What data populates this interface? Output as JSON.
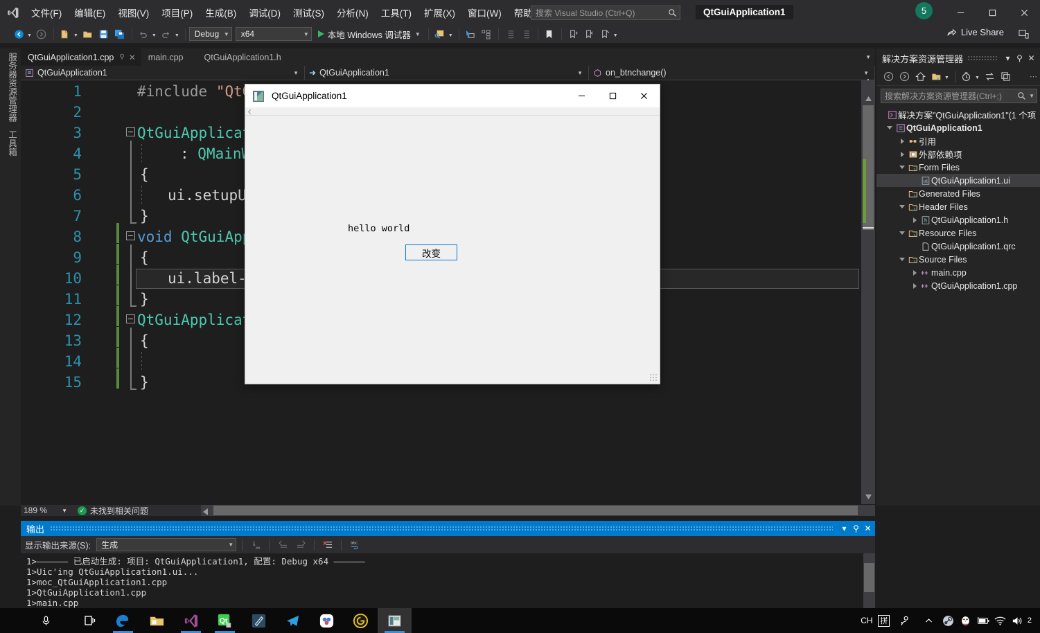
{
  "titlebar": {
    "menu": [
      "文件(F)",
      "编辑(E)",
      "视图(V)",
      "项目(P)",
      "生成(B)",
      "调试(D)",
      "测试(S)",
      "分析(N)",
      "工具(T)",
      "扩展(X)",
      "窗口(W)",
      "帮助(H)"
    ],
    "search_placeholder": "搜索 Visual Studio (Ctrl+Q)",
    "solution_name": "QtGuiApplication1",
    "notification_count": "5"
  },
  "toolbar": {
    "config": "Debug",
    "platform": "x64",
    "run_label": "本地 Windows 调试器",
    "live_share": "Live Share"
  },
  "leftstrip": {
    "server_explorer": "服务器资源管理器",
    "toolbox": "工具箱"
  },
  "tabs": [
    {
      "label": "QtGuiApplication1.cpp",
      "active": true
    },
    {
      "label": "main.cpp",
      "active": false
    },
    {
      "label": "QtGuiApplication1.h",
      "active": false
    }
  ],
  "navbar": {
    "project": "QtGuiApplication1",
    "class": "QtGuiApplication1",
    "member": "on_btnchange()"
  },
  "editor": {
    "zoom": "189 %",
    "status": "未找到相关问题",
    "lines": [
      {
        "n": "1",
        "text": "#include \"QtGuiApplication1.h\""
      },
      {
        "n": "2",
        "text": ""
      },
      {
        "n": "3",
        "text": "QtGuiApplication1::QtGuiApplication1(QWidget *parent)"
      },
      {
        "n": "4",
        "text": ": QMainWindow(parent)"
      },
      {
        "n": "5",
        "text": "{"
      },
      {
        "n": "6",
        "text": "ui.setupUi(this);"
      },
      {
        "n": "7",
        "text": "}"
      },
      {
        "n": "8",
        "text": "void QtGuiApplication1::on_btnchange()"
      },
      {
        "n": "9",
        "text": "{"
      },
      {
        "n": "10",
        "text": "ui.label->setText(\"hello world\");"
      },
      {
        "n": "11",
        "text": "}"
      },
      {
        "n": "12",
        "text": "QtGuiApplication1::~QtGuiApplication1()"
      },
      {
        "n": "13",
        "text": "{"
      },
      {
        "n": "14",
        "text": ""
      },
      {
        "n": "15",
        "text": "}"
      }
    ]
  },
  "solution_explorer": {
    "title": "解决方案资源管理器",
    "search_placeholder": "搜索解决方案资源管理器(Ctrl+;)",
    "tree": [
      {
        "label": "解决方案\"QtGuiApplication1\"(1 个项",
        "depth": 0,
        "twisty": "none",
        "icon": "solution-icon",
        "bold": false,
        "selected": false
      },
      {
        "label": "QtGuiApplication1",
        "depth": 1,
        "twisty": "down",
        "icon": "project-icon",
        "bold": true,
        "selected": false
      },
      {
        "label": "引用",
        "depth": 2,
        "twisty": "right",
        "icon": "references-icon",
        "bold": false,
        "selected": false
      },
      {
        "label": "外部依赖项",
        "depth": 2,
        "twisty": "right",
        "icon": "ext-dep-icon",
        "bold": false,
        "selected": false
      },
      {
        "label": "Form Files",
        "depth": 2,
        "twisty": "down",
        "icon": "folder-icon",
        "bold": false,
        "selected": false
      },
      {
        "label": "QtGuiApplication1.ui",
        "depth": 3,
        "twisty": "none",
        "icon": "ui-file-icon",
        "bold": false,
        "selected": true
      },
      {
        "label": "Generated Files",
        "depth": 2,
        "twisty": "none",
        "icon": "folder-icon",
        "bold": false,
        "selected": false
      },
      {
        "label": "Header Files",
        "depth": 2,
        "twisty": "down",
        "icon": "folder-icon",
        "bold": false,
        "selected": false
      },
      {
        "label": "QtGuiApplication1.h",
        "depth": 3,
        "twisty": "right",
        "icon": "h-file-icon",
        "bold": false,
        "selected": false
      },
      {
        "label": "Resource Files",
        "depth": 2,
        "twisty": "down",
        "icon": "folder-icon",
        "bold": false,
        "selected": false
      },
      {
        "label": "QtGuiApplication1.qrc",
        "depth": 3,
        "twisty": "none",
        "icon": "file-icon",
        "bold": false,
        "selected": false
      },
      {
        "label": "Source Files",
        "depth": 2,
        "twisty": "down",
        "icon": "folder-icon",
        "bold": false,
        "selected": false
      },
      {
        "label": "main.cpp",
        "depth": 3,
        "twisty": "right",
        "icon": "cpp-file-icon",
        "bold": false,
        "selected": false
      },
      {
        "label": "QtGuiApplication1.cpp",
        "depth": 3,
        "twisty": "right",
        "icon": "cpp-file-icon",
        "bold": false,
        "selected": false
      }
    ]
  },
  "output_panel": {
    "title": "输出",
    "source_label": "显示输出来源(S):",
    "source_value": "生成",
    "lines": [
      "1>—————— 已启动生成: 项目: QtGuiApplication1, 配置: Debug x64 ——————",
      "1>Uic'ing QtGuiApplication1.ui...",
      "1>moc_QtGuiApplication1.cpp",
      "1>QtGuiApplication1.cpp",
      "1>main.cpp"
    ]
  },
  "qt_window": {
    "title": "QtGuiApplication1",
    "label_text": "hello world",
    "button_text": "改变"
  },
  "taskbar": {
    "apps": [
      "task-view",
      "edge",
      "file-explorer",
      "visual-studio",
      "qt-creator",
      "designer",
      "telegram",
      "cloud-sync",
      "golang",
      "qt-app"
    ],
    "ime_lang": "CH",
    "ime_mode": "拼",
    "clock": "2"
  },
  "colors": {
    "accent": "#007acc",
    "editor_bg": "#1e1e1e",
    "chrome_bg": "#2d2d30",
    "panel_bg": "#252526",
    "qt_accent": "#0078d7"
  }
}
